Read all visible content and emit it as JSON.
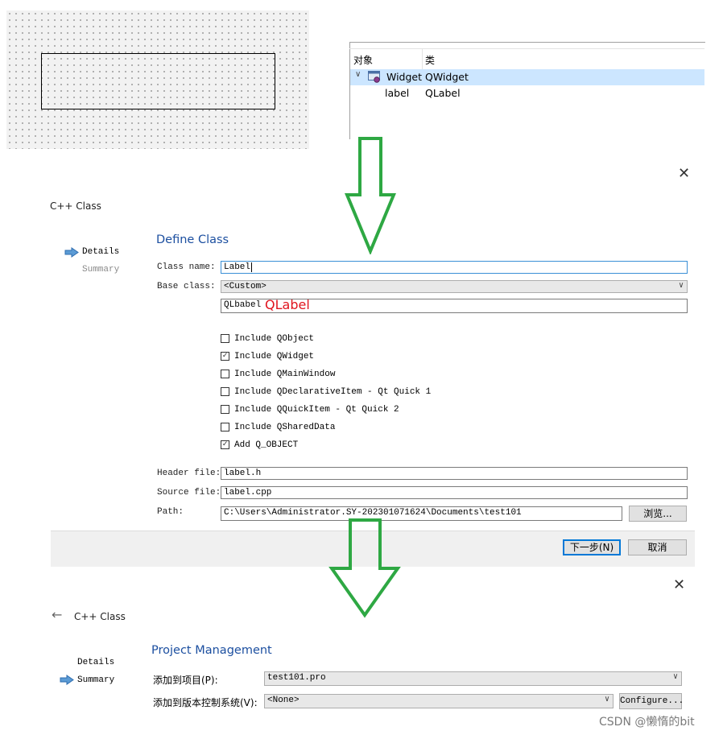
{
  "inspector": {
    "col_object": "对象",
    "col_class": "类",
    "rows": [
      {
        "object": "Widget",
        "class": "QWidget"
      },
      {
        "object": "label",
        "class": "QLabel"
      }
    ]
  },
  "dialog1": {
    "title": "C++ Class",
    "close": "✕",
    "steps": [
      "Details",
      "Summary"
    ],
    "section_title": "Define Class",
    "class_name_label": "Class name:",
    "class_name_value": "Label",
    "base_class_label": "Base class:",
    "base_class_value": "<Custom>",
    "custom_base_value": "QLbabel",
    "annotation": "QLabel",
    "checkboxes": [
      {
        "label": "Include QObject",
        "checked": false
      },
      {
        "label": "Include QWidget",
        "checked": true
      },
      {
        "label": "Include QMainWindow",
        "checked": false
      },
      {
        "label": "Include QDeclarativeItem - Qt Quick 1",
        "checked": false
      },
      {
        "label": "Include QQuickItem - Qt Quick 2",
        "checked": false
      },
      {
        "label": "Include QSharedData",
        "checked": false
      },
      {
        "label": "Add Q_OBJECT",
        "checked": true
      }
    ],
    "header_label": "Header file:",
    "header_value": "label.h",
    "source_label": "Source file:",
    "source_value": "label.cpp",
    "path_label": "Path:",
    "path_value": "C:\\Users\\Administrator.SY-202301071624\\Documents\\test101",
    "browse_button": "浏览...",
    "next_button": "下一步(N)",
    "cancel_button": "取消"
  },
  "dialog2": {
    "back": "←",
    "title": "C++ Class",
    "close": "✕",
    "steps": [
      "Details",
      "Summary"
    ],
    "section_title": "Project Management",
    "add_project_label": "添加到项目(P):",
    "add_project_value": "test101.pro",
    "add_vcs_label": "添加到版本控制系统(V):",
    "add_vcs_value": "<None>",
    "configure_button": "Configure..."
  },
  "watermark": "CSDN @懒惰的bit",
  "colors": {
    "arrow": "#2ea843",
    "accent": "#1c4fa0",
    "annotation": "#e0141e",
    "selection": "#cce6ff"
  }
}
